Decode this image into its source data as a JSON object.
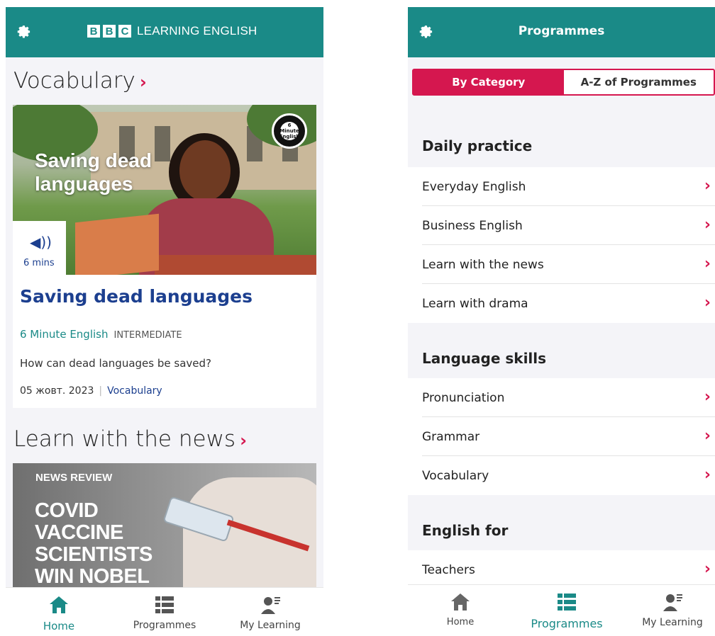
{
  "home": {
    "header": {
      "logo_letters": [
        "B",
        "B",
        "C"
      ],
      "logo_text": "LEARNING ENGLISH"
    },
    "vocab_section": {
      "title": "Vocabulary",
      "chevron": "›"
    },
    "feature": {
      "hero_title_line1": "Saving dead",
      "hero_title_line2": "languages",
      "badge_text": "6 Minute English",
      "audio_icon": "speaker-icon",
      "duration": "6 mins",
      "title": "Saving dead languages",
      "programme": "6 Minute English",
      "level": "INTERMEDIATE",
      "description": "How can dead languages be saved?",
      "date": "05 жовт. 2023",
      "category": "Vocabulary"
    },
    "news_section": {
      "title": "Learn with the news",
      "chevron": "›"
    },
    "news_card": {
      "label": "NEWS REVIEW",
      "lines": [
        "COVID",
        "VACCINE",
        "SCIENTISTS",
        "WIN NOBEL"
      ]
    },
    "nav": [
      {
        "label": "Home",
        "icon": "home-icon",
        "active": true
      },
      {
        "label": "Programmes",
        "icon": "list-icon",
        "active": false
      },
      {
        "label": "My Learning",
        "icon": "person-icon",
        "active": false
      }
    ]
  },
  "programmes": {
    "header": {
      "title": "Programmes"
    },
    "tabs": [
      {
        "label": "By Category",
        "selected": true
      },
      {
        "label": "A-Z of Programmes",
        "selected": false
      }
    ],
    "categories": [
      {
        "title": "Daily practice",
        "items": [
          "Everyday English",
          "Business English",
          "Learn with the news",
          "Learn with drama"
        ]
      },
      {
        "title": "Language skills",
        "items": [
          "Pronunciation",
          "Grammar",
          "Vocabulary"
        ]
      },
      {
        "title": "English for",
        "items": [
          "Teachers"
        ]
      }
    ],
    "chevron": "›",
    "nav": [
      {
        "label": "Home",
        "icon": "home-icon",
        "active": false
      },
      {
        "label": "Programmes",
        "icon": "list-icon",
        "active": true
      },
      {
        "label": "My Learning",
        "icon": "person-icon",
        "active": false
      }
    ]
  },
  "colors": {
    "teal": "#1a8a87",
    "accent": "#d5174f",
    "navy": "#1c3f8f"
  }
}
